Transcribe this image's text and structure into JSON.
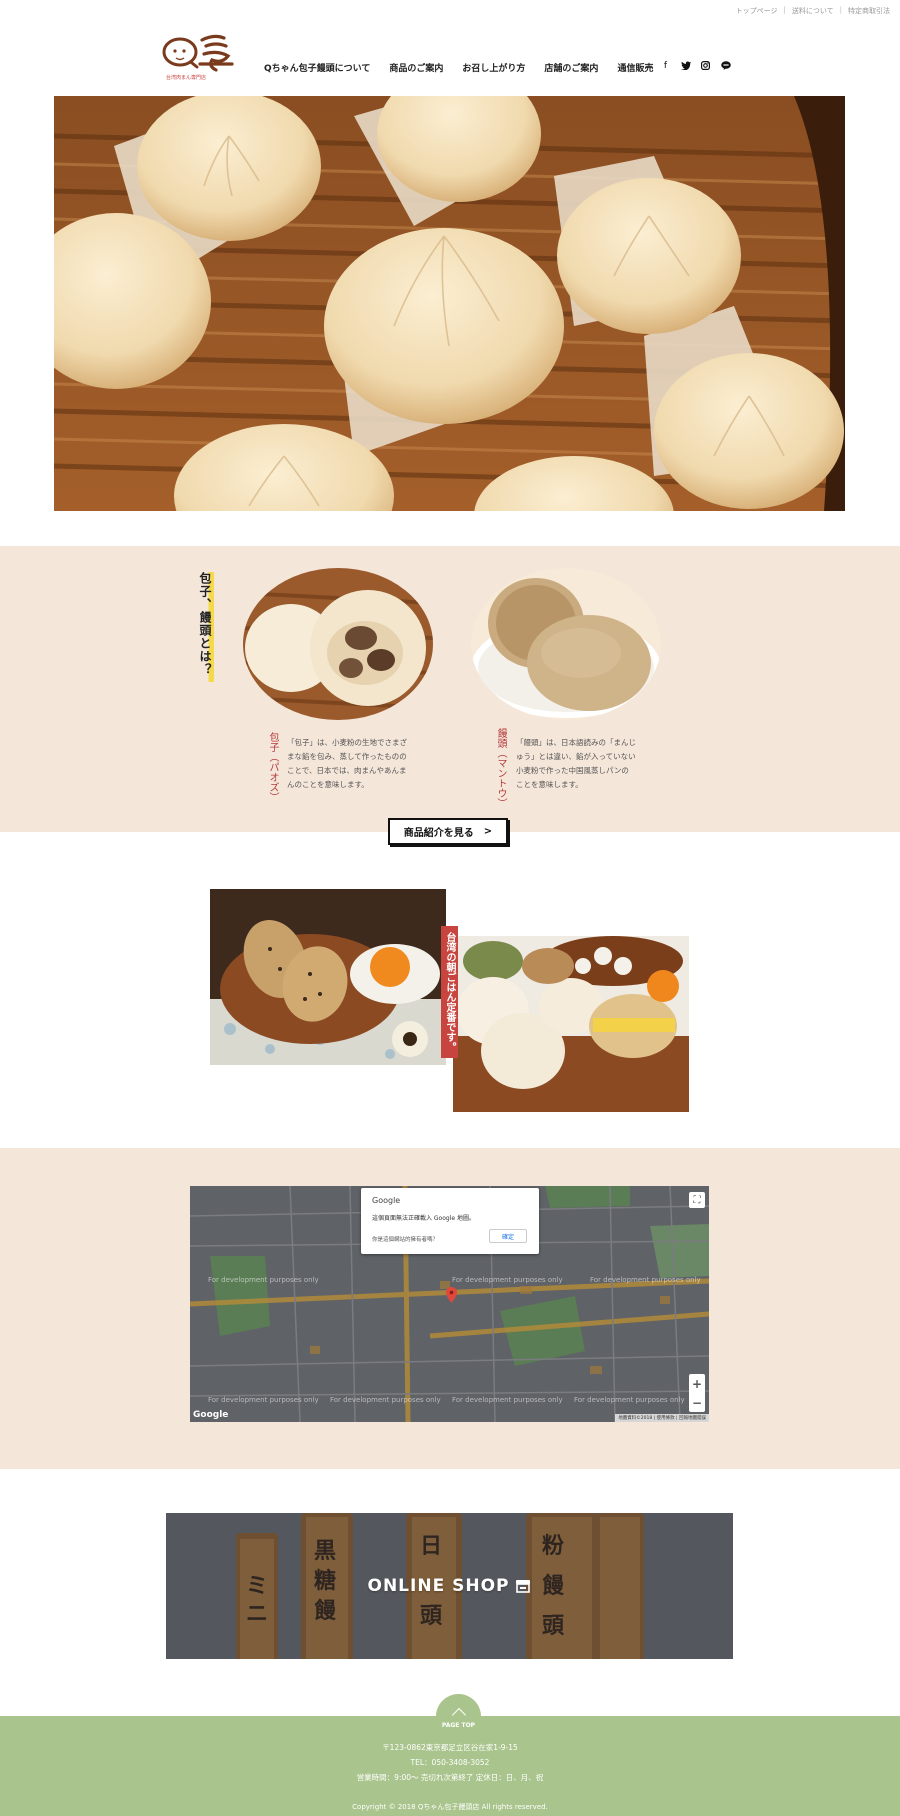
{
  "top_links": [
    "トップページ",
    "送料について",
    "特定商取引法"
  ],
  "logo": {
    "sub": "台湾肉まん専門店"
  },
  "nav": [
    "Qちゃん包子饅頭について",
    "商品のご案内",
    "お召し上がり方",
    "店舗のご案内",
    "通信販売"
  ],
  "social": [
    "facebook-icon",
    "twitter-icon",
    "instagram-icon",
    "line-icon"
  ],
  "about": {
    "title": "包子、饅頭とは？",
    "baozi": {
      "label": "包子（パオズ）",
      "desc": "「包子」は、小麦粉の生地でさまざまな餡を包み、蒸して作ったもののことで、日本では、肉まんやあんまんのことを意味します。"
    },
    "mantou": {
      "label": "饅頭（マントウ）",
      "desc": "「饅頭」は、日本語読みの「まんじゅう」とは違い、餡が入っていない小麦粉で作った中国風蒸しパンのことを意味します。"
    },
    "button": "商品紹介を見る",
    "button_arrow": ">"
  },
  "breakfast": {
    "label": "台湾の朝ごはん定番です。"
  },
  "map": {
    "dialog_title": "Google",
    "dialog_message": "這個頁面無法正確載入 Google 地圖。",
    "dialog_question": "你是這個網站的擁有者嗎？",
    "dialog_ok": "確定",
    "dev_text": "For development purposes only",
    "logo": "Google",
    "attribution": "地圖資料©2018 | 使用條款 | 回報地圖錯誤",
    "zoom_in": "+",
    "zoom_out": "−",
    "fullscreen": "⛶"
  },
  "online_shop": {
    "label": "ONLINE SHOP"
  },
  "footer": {
    "pagetop": "PAGE TOP",
    "address": "〒123-0862東京都足立区谷在家1-9-15",
    "tel": "TEL：050-3408-3052",
    "hours": "営業時間：9:00～ 売切れ次第終了 定休日：日、月、祝",
    "copyright": "Copyright © 2018 Qちゃん包子饅頭店 All rights reserved."
  },
  "colors": {
    "accent_red": "#c8443f",
    "highlight_yellow": "#f4d94a",
    "section_bg": "#f5e6da",
    "footer_green": "#a9c48c"
  }
}
